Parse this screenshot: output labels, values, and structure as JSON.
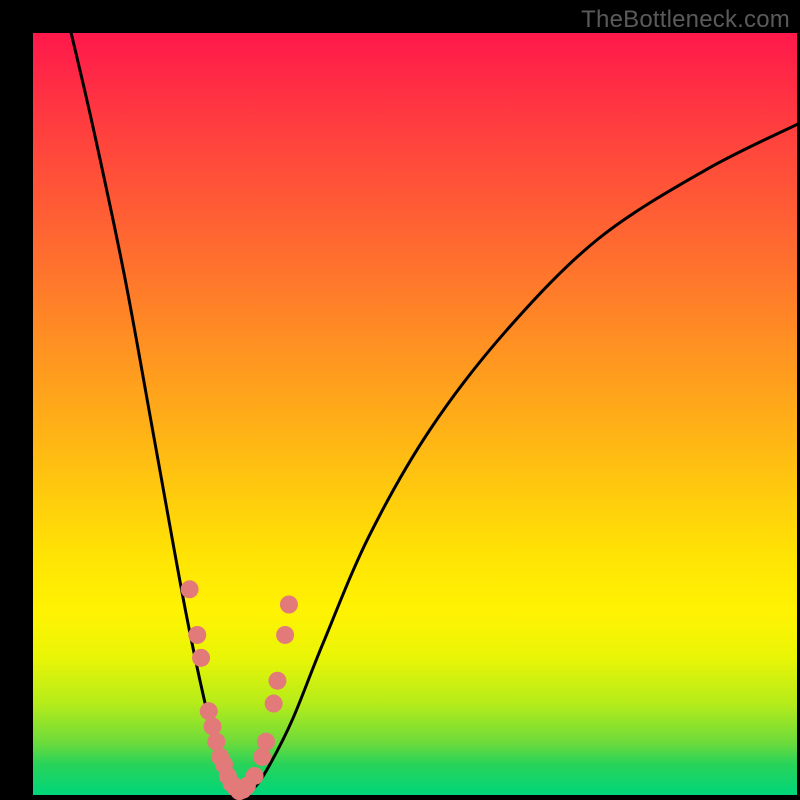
{
  "watermark": "TheBottleneck.com",
  "colors": {
    "frame": "#000000",
    "curve": "#000000",
    "dots": "#e27a7a",
    "watermark": "#5a5a5a"
  },
  "chart_data": {
    "type": "line",
    "title": "",
    "xlabel": "",
    "ylabel": "",
    "xlim": [
      0,
      100
    ],
    "ylim": [
      0,
      100
    ],
    "grid": false,
    "legend": false,
    "note": "V-shaped bottleneck curve. y ≈ 100 means severe bottleneck (red), y ≈ 0 means balanced (green). Minimum (0% bottleneck) around x ≈ 27. Values estimated from pixels as no axes/ticks shown.",
    "series": [
      {
        "name": "bottleneck-curve",
        "x": [
          5,
          8,
          12,
          16,
          20,
          23,
          25,
          27,
          29,
          31,
          34,
          38,
          44,
          52,
          62,
          74,
          88,
          100
        ],
        "y": [
          100,
          87,
          68,
          46,
          24,
          10,
          3,
          0,
          1,
          4,
          10,
          20,
          34,
          48,
          61,
          73,
          82,
          88
        ]
      }
    ],
    "highlight_points": {
      "name": "marker-dots",
      "note": "Salmon dots clustered near the bottom of the V on both arms.",
      "x": [
        20.5,
        21.5,
        22,
        23,
        23.5,
        24,
        24.5,
        25,
        25.5,
        26,
        26.5,
        27,
        27.5,
        28,
        29,
        30,
        30.5,
        31.5,
        32,
        33,
        33.5
      ],
      "y": [
        27,
        21,
        18,
        11,
        9,
        7,
        5,
        4,
        2.5,
        1.5,
        1,
        0.5,
        0.7,
        1.2,
        2.5,
        5,
        7,
        12,
        15,
        21,
        25
      ]
    }
  }
}
